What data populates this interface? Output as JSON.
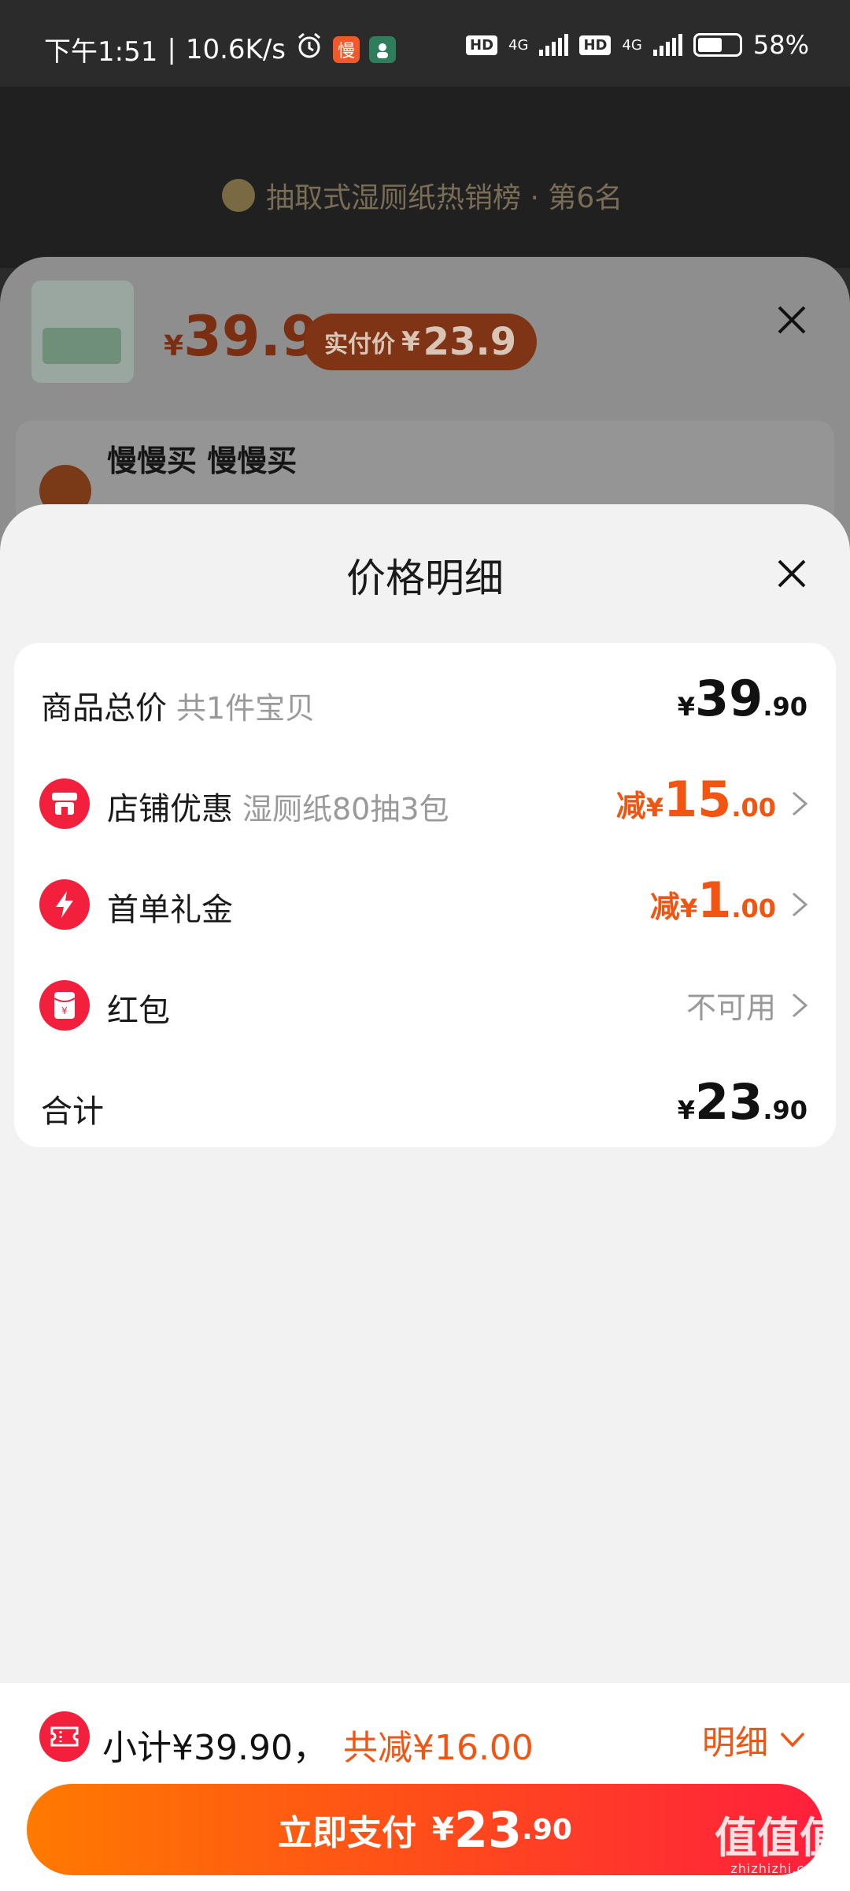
{
  "status_bar": {
    "time": "下午1:51",
    "net_speed": "10.6K/s",
    "app_badge": "慢",
    "hd1": "HD",
    "net1": "4G",
    "hd2": "HD",
    "net2": "4G",
    "battery": "58%"
  },
  "background": {
    "rank_text": "抽取式湿厕纸热销榜 · 第6名"
  },
  "sku_sheet": {
    "price_symbol": "¥",
    "price": "39.9",
    "pay_label": "实付价",
    "pay_symbol": "¥",
    "pay_price": "23.9",
    "address_name": "慢慢买 慢慢买"
  },
  "price_detail": {
    "title": "价格明细",
    "rows": [
      {
        "label": "商品总价",
        "sub": "共1件宝贝",
        "prefix": "",
        "yen": "¥",
        "int": "39",
        "dec": ".90",
        "icon": ""
      },
      {
        "label": "店铺优惠",
        "sub": "湿厕纸80抽3包",
        "prefix": "减",
        "yen": "¥",
        "int": "15",
        "dec": ".00",
        "icon": "store-icon"
      },
      {
        "label": "首单礼金",
        "sub": "",
        "prefix": "减",
        "yen": "¥",
        "int": "1",
        "dec": ".00",
        "icon": "lightning-icon"
      },
      {
        "label": "红包",
        "sub": "",
        "value_text": "不可用",
        "icon": "red-envelope-icon"
      },
      {
        "label": "合计",
        "sub": "",
        "prefix": "",
        "yen": "¥",
        "int": "23",
        "dec": ".90",
        "icon": ""
      }
    ]
  },
  "bottom_bar": {
    "subtotal": "小计¥39.90，",
    "saved": "共减¥16.00",
    "detail_label": "明细",
    "pay_label": "立即支付",
    "pay_yen": "¥",
    "pay_int": "23",
    "pay_dec": ".90"
  },
  "watermark": {
    "text": "值值值",
    "sub": "zhizhizhi.com"
  },
  "colors": {
    "accent": "#f25511",
    "icon_red": "#f2203d",
    "pay_gradient_start": "#ff7a00",
    "pay_gradient_end": "#ff1f3d"
  }
}
